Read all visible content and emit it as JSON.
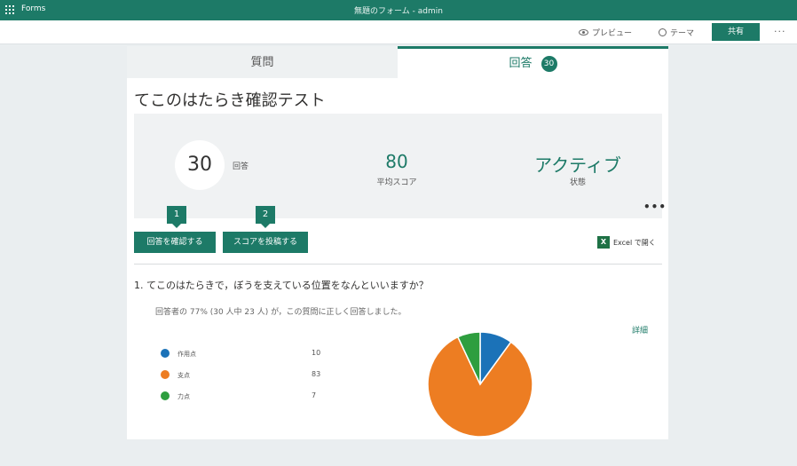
{
  "topbar": {
    "app_name": "Forms",
    "doc_title": "無題のフォーム - admin"
  },
  "cmdbar": {
    "preview": "プレビュー",
    "theme": "テーマ",
    "share": "共有",
    "more": "···"
  },
  "tabs": {
    "questions": "質問",
    "responses": "回答",
    "responses_badge": "30"
  },
  "form": {
    "title": "てこのはたらき確認テスト"
  },
  "summary": {
    "responses": {
      "value": "30",
      "label": "回答"
    },
    "avg_score": {
      "value": "80",
      "label": "平均スコア"
    },
    "status": {
      "value": "アクティブ",
      "label": "状態"
    },
    "more": "•••"
  },
  "callouts": [
    "1",
    "2"
  ],
  "actions": {
    "review": "回答を確認する",
    "post_scores": "スコアを投稿する",
    "open_excel": "Excel で開く",
    "excel_icon": "X"
  },
  "question": {
    "text": "1. てこのはたらきで，ぼうを支えている位置をなんといいますか？",
    "correct_summary": "回答者の 77% (30 人中 23 人) が，この質問に正しく回答しました。",
    "details": "詳細"
  },
  "chart_data": {
    "type": "pie",
    "categories": [
      "作用点",
      "支点",
      "力点"
    ],
    "values": [
      10,
      83,
      7
    ],
    "colors": [
      "#1b72b8",
      "#ed7d22",
      "#2e9e3f"
    ]
  }
}
